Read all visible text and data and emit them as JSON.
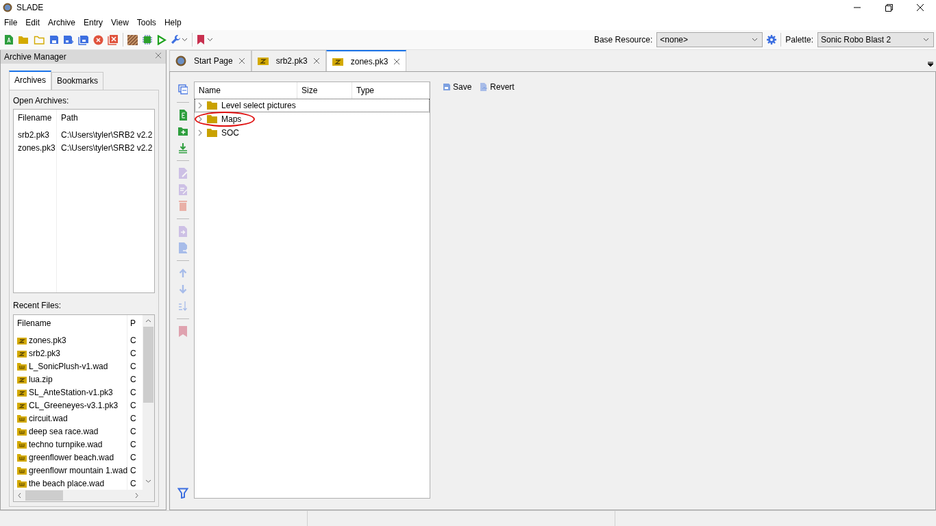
{
  "window": {
    "title": "SLADE"
  },
  "menu": [
    "File",
    "Edit",
    "Archive",
    "Entry",
    "View",
    "Tools",
    "Help"
  ],
  "base_resource": {
    "label": "Base Resource:",
    "value": "<none>"
  },
  "palette": {
    "label": "Palette:",
    "value": "Sonic Robo Blast 2"
  },
  "archive_manager": {
    "title": "Archive Manager",
    "tabs": [
      {
        "label": "Archives",
        "selected": true
      },
      {
        "label": "Bookmarks",
        "selected": false
      }
    ],
    "open_archives": {
      "label": "Open Archives:",
      "columns": [
        "Filename",
        "Path"
      ],
      "rows": [
        {
          "filename": "srb2.pk3",
          "path": "C:\\Users\\tyler\\SRB2 v2.2"
        },
        {
          "filename": "zones.pk3",
          "path": "C:\\Users\\tyler\\SRB2 v2.2"
        }
      ]
    },
    "recent_files": {
      "label": "Recent Files:",
      "columns": [
        "Filename",
        "P"
      ],
      "rows": [
        {
          "filename": "zones.pk3",
          "path": "C",
          "kind": "zip"
        },
        {
          "filename": "srb2.pk3",
          "path": "C",
          "kind": "zip"
        },
        {
          "filename": "L_SonicPlush-v1.wad",
          "path": "C",
          "kind": "wad"
        },
        {
          "filename": "lua.zip",
          "path": "C",
          "kind": "zip"
        },
        {
          "filename": "SL_AnteStation-v1.pk3",
          "path": "C",
          "kind": "zip"
        },
        {
          "filename": "CL_Greeneyes-v3.1.pk3",
          "path": "C",
          "kind": "zip"
        },
        {
          "filename": "circuit.wad",
          "path": "C",
          "kind": "wad"
        },
        {
          "filename": "deep sea race.wad",
          "path": "C",
          "kind": "wad"
        },
        {
          "filename": "techno turnpike.wad",
          "path": "C",
          "kind": "wad"
        },
        {
          "filename": "greenflower beach.wad",
          "path": "C",
          "kind": "wad"
        },
        {
          "filename": "greenflowr mountain 1.wad",
          "path": "C",
          "kind": "wad"
        },
        {
          "filename": "the beach place.wad",
          "path": "C",
          "kind": "wad"
        }
      ]
    }
  },
  "doc_tabs": [
    {
      "label": "Start Page",
      "kind": "start",
      "selected": false
    },
    {
      "label": "srb2.pk3",
      "kind": "zip",
      "selected": false
    },
    {
      "label": "zones.pk3",
      "kind": "zip",
      "selected": true
    }
  ],
  "entry_toolbar": [
    {
      "kind": "collapse",
      "disabled": false
    },
    {
      "kind": "separator"
    },
    {
      "kind": "new-entry",
      "disabled": false
    },
    {
      "kind": "new-folder",
      "disabled": false
    },
    {
      "kind": "import",
      "disabled": false
    },
    {
      "kind": "separator"
    },
    {
      "kind": "rename",
      "disabled": true
    },
    {
      "kind": "rename-each",
      "disabled": true
    },
    {
      "kind": "delete",
      "disabled": true
    },
    {
      "kind": "separator"
    },
    {
      "kind": "export",
      "disabled": true
    },
    {
      "kind": "export-as",
      "disabled": true
    },
    {
      "kind": "separator"
    },
    {
      "kind": "move-up",
      "disabled": true
    },
    {
      "kind": "move-down",
      "disabled": true
    },
    {
      "kind": "sort",
      "disabled": true
    },
    {
      "kind": "separator"
    },
    {
      "kind": "bookmark",
      "disabled": true
    }
  ],
  "entry_list": {
    "columns": [
      "Name",
      "Size",
      "Type"
    ],
    "rows": [
      {
        "name": "Level select pictures",
        "focused": true,
        "circled": false
      },
      {
        "name": "Maps",
        "focused": false,
        "circled": true
      },
      {
        "name": "SOC",
        "focused": false,
        "circled": false
      }
    ]
  },
  "entry_actions": [
    "Save",
    "Revert"
  ]
}
